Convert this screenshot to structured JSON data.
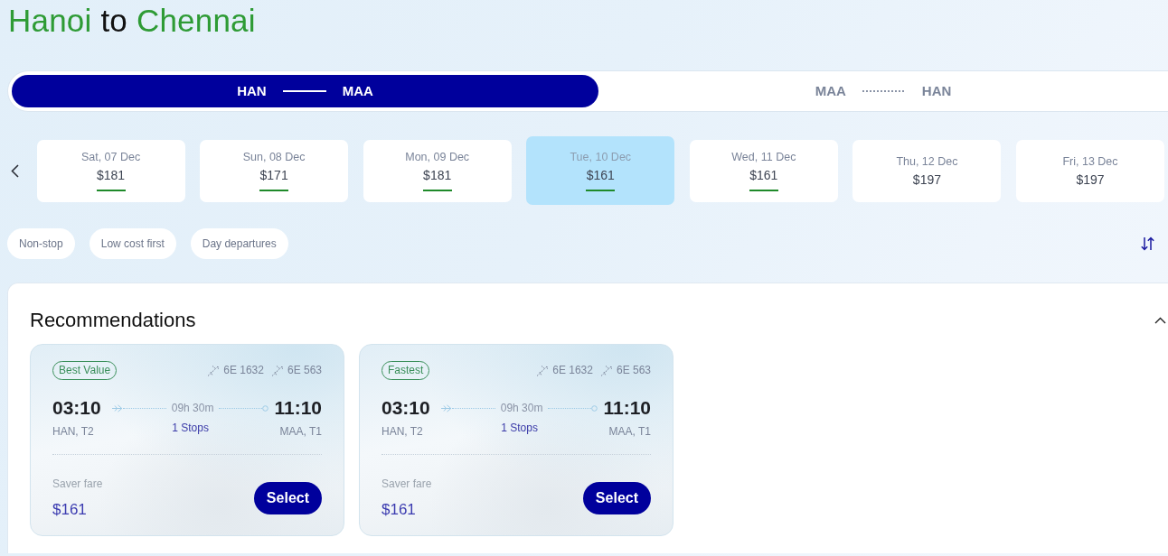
{
  "title": {
    "origin": "Hanoi",
    "connector": "to",
    "destination": "Chennai"
  },
  "legs": [
    {
      "from": "HAN",
      "to": "MAA",
      "selected": true
    },
    {
      "from": "MAA",
      "to": "HAN",
      "selected": false
    }
  ],
  "dates": [
    {
      "date": "Sat, 07 Dec",
      "price": "$181",
      "low_fare": true,
      "selected": false
    },
    {
      "date": "Sun, 08 Dec",
      "price": "$171",
      "low_fare": true,
      "selected": false
    },
    {
      "date": "Mon, 09 Dec",
      "price": "$181",
      "low_fare": true,
      "selected": false
    },
    {
      "date": "Tue, 10 Dec",
      "price": "$161",
      "low_fare": true,
      "selected": true
    },
    {
      "date": "Wed, 11 Dec",
      "price": "$161",
      "low_fare": true,
      "selected": false
    },
    {
      "date": "Thu, 12 Dec",
      "price": "$197",
      "low_fare": false,
      "selected": false
    },
    {
      "date": "Fri, 13 Dec",
      "price": "$197",
      "low_fare": false,
      "selected": false
    }
  ],
  "filters": [
    {
      "label": "Non-stop",
      "selected": false
    },
    {
      "label": "Low cost first",
      "selected": false
    },
    {
      "label": "Day departures",
      "selected": false
    }
  ],
  "recommendations": {
    "title": "Recommendations",
    "expanded": true,
    "cards": [
      {
        "tag": "Best Value",
        "flight_numbers": [
          "6E 1632",
          "6E 563"
        ],
        "departure": {
          "time": "03:10",
          "airport": "HAN, T2"
        },
        "duration": "09h 30m",
        "stops": "1 Stops",
        "arrival": {
          "time": "11:10",
          "airport": "MAA, T1"
        },
        "fare_type": "Saver fare",
        "price": "$161",
        "button": "Select"
      },
      {
        "tag": "Fastest",
        "flight_numbers": [
          "6E 1632",
          "6E 563"
        ],
        "departure": {
          "time": "03:10",
          "airport": "HAN, T2"
        },
        "duration": "09h 30m",
        "stops": "1 Stops",
        "arrival": {
          "time": "11:10",
          "airport": "MAA, T1"
        },
        "fare_type": "Saver fare",
        "price": "$161",
        "button": "Select"
      }
    ]
  }
}
